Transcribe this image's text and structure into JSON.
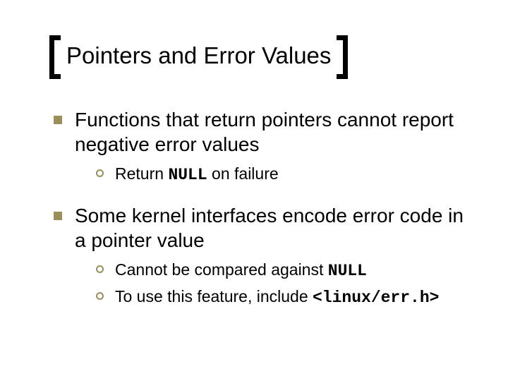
{
  "title": "Pointers and Error Values",
  "items": [
    {
      "text": "Functions that return pointers cannot report negative error values",
      "sub": [
        {
          "pre": "Return ",
          "code": "NULL",
          "post": " on failure"
        }
      ]
    },
    {
      "text": "Some kernel interfaces encode error code in a pointer value",
      "sub": [
        {
          "pre": "Cannot be compared against ",
          "code": "NULL",
          "post": ""
        },
        {
          "pre": "To use this feature, include ",
          "code": "<linux/err.h>",
          "post": ""
        }
      ]
    }
  ]
}
